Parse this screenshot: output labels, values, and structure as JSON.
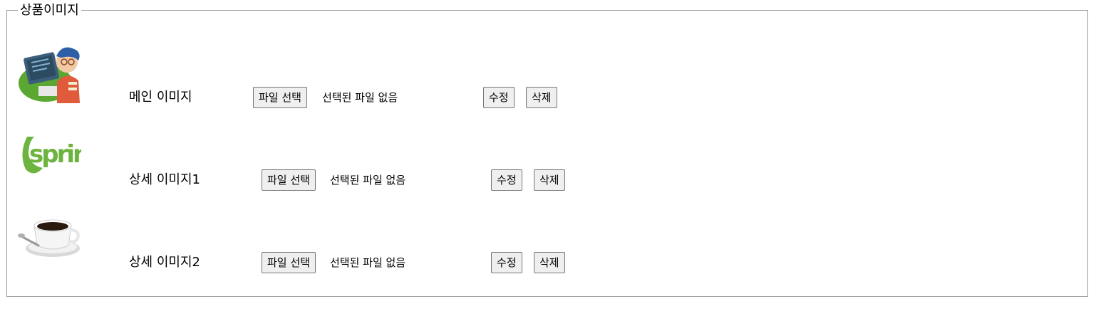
{
  "fieldset": {
    "legend": "상품이미지"
  },
  "rows": [
    {
      "label": "메인 이미지",
      "image_icon": "developer-illustration-icon",
      "file_button": "파일 선택",
      "file_status": "선택된 파일 없음",
      "edit_button": "수정",
      "delete_button": "삭제"
    },
    {
      "label": "상세 이미지1",
      "image_icon": "spring-logo-icon",
      "image_text": "spring",
      "file_button": "파일 선택",
      "file_status": "선택된 파일 없음",
      "edit_button": "수정",
      "delete_button": "삭제"
    },
    {
      "label": "상세 이미지2",
      "image_icon": "coffee-cup-icon",
      "file_button": "파일 선택",
      "file_status": "선택된 파일 없음",
      "edit_button": "수정",
      "delete_button": "삭제"
    }
  ],
  "colors": {
    "border": "#9a9a9a",
    "button_bg": "#efefef",
    "spring_green": "#6db33f"
  }
}
